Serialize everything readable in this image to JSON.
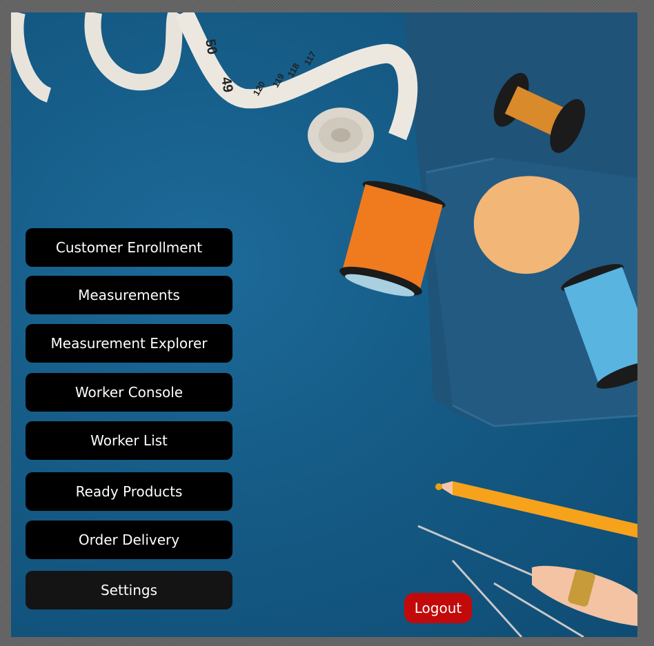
{
  "menu": {
    "items": [
      {
        "label": "Customer Enrollment"
      },
      {
        "label": "Measurements"
      },
      {
        "label": "Measurement Explorer"
      },
      {
        "label": "Worker Console"
      },
      {
        "label": "Worker List"
      },
      {
        "label": "Ready Products"
      },
      {
        "label": "Order Delivery"
      },
      {
        "label": "Settings"
      }
    ]
  },
  "logout": {
    "label": "Logout"
  },
  "tape_numbers": [
    "50",
    "49",
    "120",
    "119",
    "118",
    "117"
  ],
  "colors": {
    "background_blue": "#155b86",
    "button_black": "#000000",
    "logout_red": "#c20a0a",
    "spool_orange": "#f07a1e",
    "spool_blue": "#5ab4e0"
  }
}
